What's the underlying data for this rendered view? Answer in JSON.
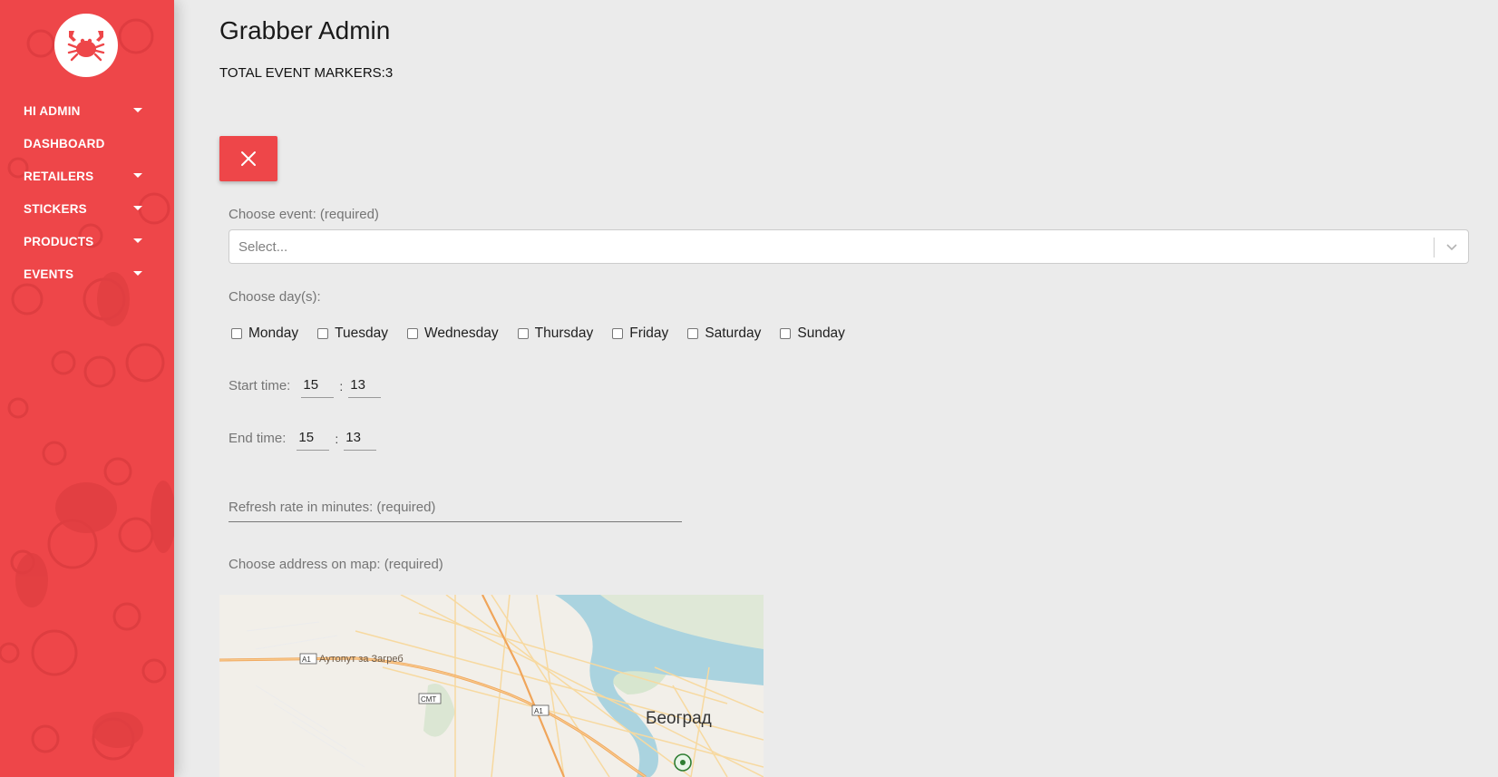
{
  "sidebar": {
    "logo_icon": "crab-icon",
    "items": [
      {
        "label": "HI ADMIN",
        "has_caret": true
      },
      {
        "label": "DASHBOARD",
        "has_caret": false
      },
      {
        "label": "RETAILERS",
        "has_caret": true
      },
      {
        "label": "STICKERS",
        "has_caret": true
      },
      {
        "label": "PRODUCTS",
        "has_caret": true
      },
      {
        "label": "EVENTS",
        "has_caret": true
      }
    ]
  },
  "header": {
    "title": "Grabber Admin",
    "total_markers": "TOTAL EVENT MARKERS:3"
  },
  "form": {
    "close_icon": "close-icon",
    "event_label": "Choose event: (required)",
    "event_placeholder": "Select...",
    "days_label": "Choose day(s):",
    "days": [
      "Monday",
      "Tuesday",
      "Wednesday",
      "Thursday",
      "Friday",
      "Saturday",
      "Sunday"
    ],
    "start_label": "Start time:",
    "start_hour": "15",
    "start_minute": "13",
    "end_label": "End time:",
    "end_hour": "15",
    "end_minute": "13",
    "time_separator": ":",
    "refresh_placeholder": "Refresh rate in minutes: (required)",
    "map_label": "Choose address on map: (required)"
  },
  "map": {
    "highway_badge_1": "A1",
    "highway_name": "Аутопут за Загреб",
    "badge_smt": "СМТ",
    "highway_badge_2": "A1",
    "city": "Београд"
  },
  "colors": {
    "brand_red": "#ee4649",
    "background": "#ebebeb"
  }
}
